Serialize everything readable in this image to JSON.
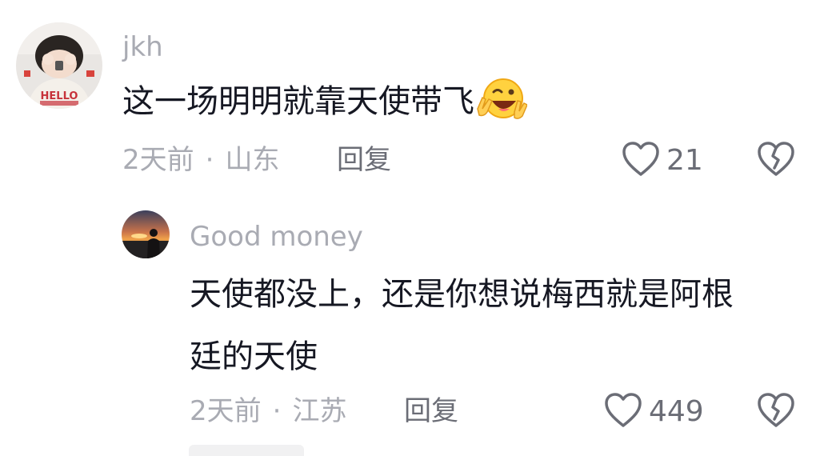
{
  "comments": [
    {
      "username": "jkh",
      "text": "这一场明明就靠天使带飞",
      "emoji": "grinning-wink-peace-emoji",
      "time": "2天前",
      "separator": "·",
      "location": "山东",
      "reply_label": "回复",
      "likes": "21"
    },
    {
      "username": "Good money",
      "text_line1": "天使都没上，还是你想说梅西就是阿根",
      "text_line2": "廷的天使",
      "time": "2天前",
      "separator": "·",
      "location": "江苏",
      "reply_label": "回复",
      "likes": "449"
    }
  ],
  "icons": {
    "like": "heart-outline-icon",
    "dislike": "broken-heart-icon"
  },
  "colors": {
    "meta_text": "#a9abb3",
    "action_text": "#6b6d76",
    "content_text": "#161823",
    "icon": "#6b6d76"
  }
}
